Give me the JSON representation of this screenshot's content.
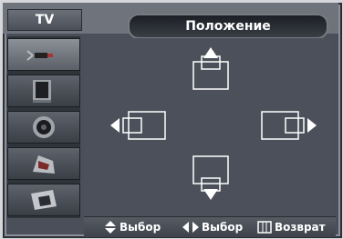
{
  "header": {
    "tv_label": "TV",
    "title": "Положение"
  },
  "sidebar": {
    "items": [
      {
        "icon": "antenna-icon",
        "label": ""
      },
      {
        "icon": "picture-icon",
        "label": ""
      },
      {
        "icon": "speaker-icon",
        "label": ""
      },
      {
        "icon": "channel-icon",
        "label": ""
      },
      {
        "icon": "setup-icon",
        "label": ""
      }
    ]
  },
  "hints": {
    "move_label": "Выбор",
    "select_label": "Выбор",
    "return_label": "Возврат"
  },
  "colors": {
    "accent": "#ffffff",
    "panel": "#4b505a",
    "sidebar_selected": "#8c9198"
  }
}
